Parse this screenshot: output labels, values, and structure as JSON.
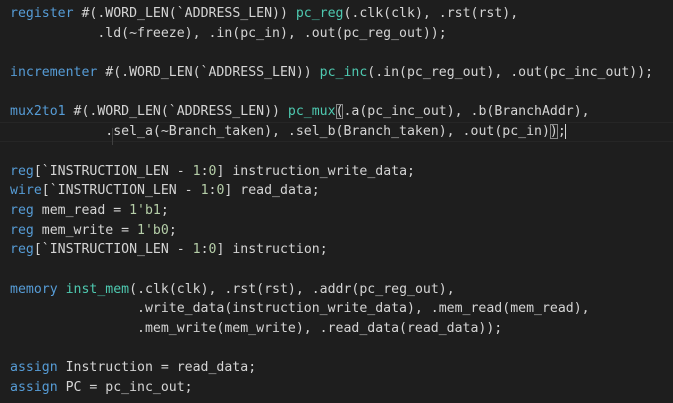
{
  "editor": {
    "lines": [
      [
        {
          "t": "register",
          "c": "kw"
        },
        {
          "t": " #(.WORD_LEN(`ADDRESS_LEN)) ",
          "c": "txt"
        },
        {
          "t": "pc_reg",
          "c": "fn"
        },
        {
          "t": "(.clk(clk), .rst(rst),",
          "c": "txt"
        }
      ],
      [
        {
          "t": "           .ld(~freeze), .in(pc_in), .out(pc_reg_out));",
          "c": "txt"
        }
      ],
      [],
      [
        {
          "t": "incrementer",
          "c": "kw"
        },
        {
          "t": " #(.WORD_LEN(`ADDRESS_LEN)) ",
          "c": "txt"
        },
        {
          "t": "pc_inc",
          "c": "fn"
        },
        {
          "t": "(.in(pc_reg_out), .out(pc_inc_out));",
          "c": "txt"
        }
      ],
      [],
      [
        {
          "t": "mux2to1",
          "c": "kw"
        },
        {
          "t": " #(.WORD_LEN(`ADDRESS_LEN)) ",
          "c": "txt"
        },
        {
          "t": "pc_mux",
          "c": "fn"
        },
        {
          "t": "(",
          "c": "txt",
          "bracket": true
        },
        {
          "t": ".a(pc_inc_out), .b(BranchAddr),",
          "c": "txt"
        }
      ],
      [
        {
          "t": "            .",
          "c": "txt"
        },
        {
          "t": "sel_a(~Branch_taken), .sel_b(Branch_taken), .out(pc_in)",
          "c": "txt"
        },
        {
          "t": ")",
          "c": "txt",
          "bracket": true
        },
        {
          "t": ";",
          "c": "txt"
        }
      ],
      [],
      [
        {
          "t": "reg",
          "c": "kw"
        },
        {
          "t": "[`INSTRUCTION_LEN - ",
          "c": "txt"
        },
        {
          "t": "1",
          "c": "num"
        },
        {
          "t": ":",
          "c": "txt"
        },
        {
          "t": "0",
          "c": "num"
        },
        {
          "t": "] instruction_write_data;",
          "c": "txt"
        }
      ],
      [
        {
          "t": "wire",
          "c": "kw"
        },
        {
          "t": "[`INSTRUCTION_LEN - ",
          "c": "txt"
        },
        {
          "t": "1",
          "c": "num"
        },
        {
          "t": ":",
          "c": "txt"
        },
        {
          "t": "0",
          "c": "num"
        },
        {
          "t": "] read_data;",
          "c": "txt"
        }
      ],
      [
        {
          "t": "reg",
          "c": "kw"
        },
        {
          "t": " mem_read = ",
          "c": "txt"
        },
        {
          "t": "1'b1",
          "c": "num"
        },
        {
          "t": ";",
          "c": "txt"
        }
      ],
      [
        {
          "t": "reg",
          "c": "kw"
        },
        {
          "t": " mem_write = ",
          "c": "txt"
        },
        {
          "t": "1'b0",
          "c": "num"
        },
        {
          "t": ";",
          "c": "txt"
        }
      ],
      [
        {
          "t": "reg",
          "c": "kw"
        },
        {
          "t": "[`INSTRUCTION_LEN - ",
          "c": "txt"
        },
        {
          "t": "1",
          "c": "num"
        },
        {
          "t": ":",
          "c": "txt"
        },
        {
          "t": "0",
          "c": "num"
        },
        {
          "t": "] instruction;",
          "c": "txt"
        }
      ],
      [],
      [
        {
          "t": "memory",
          "c": "kw"
        },
        {
          "t": " ",
          "c": "txt"
        },
        {
          "t": "inst_mem",
          "c": "fn"
        },
        {
          "t": "(.clk(clk), .rst(rst), .addr(pc_reg_out),",
          "c": "txt"
        }
      ],
      [
        {
          "t": "                .write_data(instruction_write_data), .mem_read(mem_read),",
          "c": "txt"
        }
      ],
      [
        {
          "t": "                .mem_write(mem_write), .read_data(read_data));",
          "c": "txt"
        }
      ],
      [],
      [
        {
          "t": "assign",
          "c": "kw"
        },
        {
          "t": " Instruction = read_data;",
          "c": "txt"
        }
      ],
      [
        {
          "t": "assign",
          "c": "kw"
        },
        {
          "t": " PC = pc_inc_out;",
          "c": "txt"
        }
      ]
    ],
    "colors": {
      "background": "#1e1e1e",
      "keyword": "#569cd6",
      "module_instance": "#4ec9b0",
      "number": "#b5cea8",
      "text": "#d4d4d4"
    }
  }
}
